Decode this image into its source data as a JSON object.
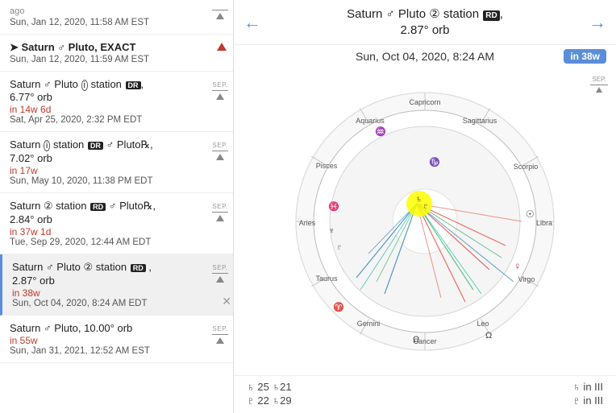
{
  "left_panel": {
    "events": [
      {
        "id": "e0",
        "date_small": "ago",
        "date": "Sun, Jan 12, 2020, 11:58 AM EST",
        "has_sep": true,
        "sep_type": "line_up"
      },
      {
        "id": "e1",
        "title": "➤ Saturn ♂ Pluto, EXACT",
        "date": "Sun, Jan 12, 2020, 11:59 AM EST",
        "bold": true,
        "has_red_triangle": true
      },
      {
        "id": "e2",
        "title": "Saturn ♂ Pluto ➀ station DR ,",
        "title2": "6.77° orb",
        "badge": "in 14w 6d",
        "date": "Sat, Apr 25, 2020, 2:32 PM EDT",
        "has_sep": true,
        "sep_type": "sep_label"
      },
      {
        "id": "e3",
        "title": "Saturn ➀ station DR ♂ Pluto℞,",
        "title2": "7.02° orb",
        "badge": "in 17w",
        "date": "Sun, May 10, 2020, 11:38 PM EDT",
        "has_sep": true,
        "sep_type": "sep_label"
      },
      {
        "id": "e4",
        "title": "Saturn ② station RD ♂ Pluto℞,",
        "title2": "2.84° orb",
        "badge": "in 37w 1d",
        "date": "Tue, Sep 29, 2020, 12:44 AM EDT",
        "has_sep": true,
        "sep_type": "sep_label"
      },
      {
        "id": "e5",
        "title": "Saturn ♂ Pluto ② station RD ,",
        "title2": "2.87° orb",
        "badge": "in 38w",
        "date": "Sun, Oct 04, 2020, 8:24 AM EDT",
        "highlighted": true,
        "has_sep": true,
        "sep_type": "sep_label",
        "has_x": true
      },
      {
        "id": "e6",
        "title": "Saturn ♂ Pluto, 10.00° orb",
        "badge": "in 55w",
        "date": "Sun, Jan 31, 2021, 12:52 AM EST",
        "has_sep": true,
        "sep_type": "sep_label"
      }
    ]
  },
  "right_panel": {
    "header_title": "Saturn ♂ Pluto ② station",
    "header_title2": "RD , 2.87° orb",
    "date": "Sun, Oct 04, 2020, 8:24 AM",
    "badge": "in 38w",
    "nav_left": "←",
    "nav_right": "→",
    "sep_label": "SEP.",
    "zodiac_signs": [
      "Capricorn",
      "Sagittarius",
      "Scorpio",
      "Libra",
      "Virgo",
      "Leo",
      "Cancer",
      "Gemini",
      "Taurus",
      "Aries",
      "Pisces",
      "Aquarius"
    ],
    "bottom_left": [
      "♄ 25 ♄21",
      "♇ 22 ♄29"
    ],
    "bottom_right": [
      "♄ in III",
      "♇ in III"
    ]
  }
}
